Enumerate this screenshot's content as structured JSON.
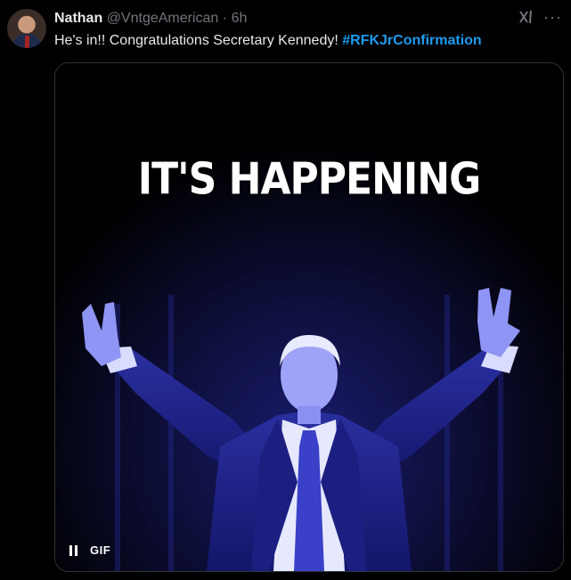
{
  "author": {
    "name": "Nathan",
    "handle": "@VntgeAmerican",
    "separator": "·",
    "time": "6h"
  },
  "tweet": {
    "text": "He's in!! Congratulations Secretary Kennedy! ",
    "hashtag": "#RFKJrConfirmation"
  },
  "media": {
    "caption": "IT'S HAPPENING",
    "badge": "GIF"
  },
  "icons": {
    "grok": "grok-icon",
    "more": "more-icon",
    "pause": "pause-icon"
  },
  "colors": {
    "background": "#000000",
    "text": "#e7e9ea",
    "muted": "#71767b",
    "link": "#1d9bf0",
    "image_tint": "#3b3fd6"
  }
}
